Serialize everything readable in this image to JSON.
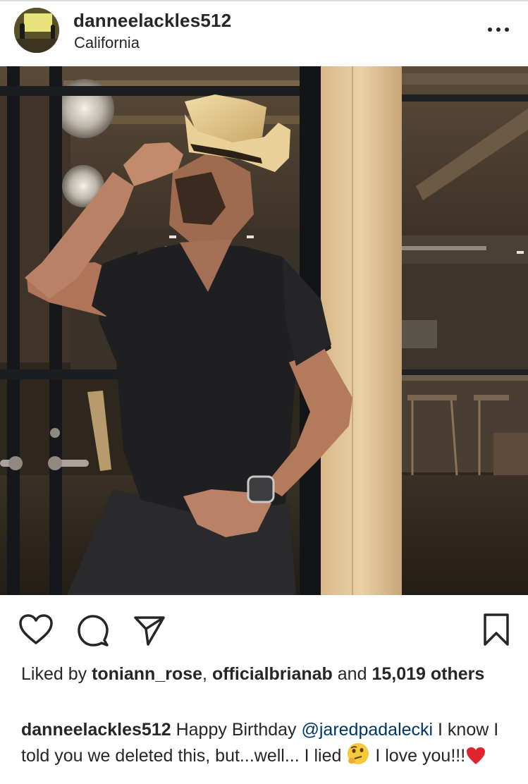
{
  "post": {
    "username": "danneelackles512",
    "location": "California",
    "more_icon": "more-horizontal-icon"
  },
  "actions": {
    "like_icon": "heart-icon",
    "comment_icon": "comment-icon",
    "share_icon": "paper-plane-icon",
    "save_icon": "bookmark-icon"
  },
  "likes": {
    "prefix": "Liked by ",
    "user1": "toniann_rose",
    "sep": ", ",
    "user2": "officialbrianab",
    "and": " and ",
    "count": "15,019",
    "others": "others"
  },
  "caption": {
    "username": "danneelackles512",
    "text1": " Happy Birthday ",
    "mention": "@jaredpadalecki",
    "text2": " I know I told you we deleted this, but...well... I lied ",
    "text3": " I love you!!!"
  },
  "colors": {
    "text": "#262626",
    "mention": "#003569",
    "heart": "#e0242c"
  }
}
